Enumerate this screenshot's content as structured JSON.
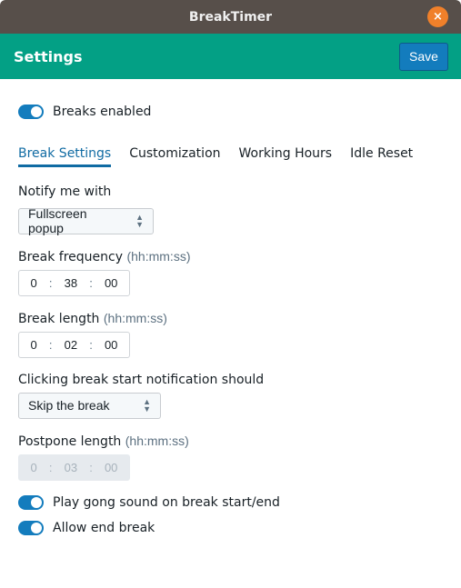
{
  "window": {
    "title": "BreakTimer",
    "close_icon": "×"
  },
  "header": {
    "title": "Settings",
    "save_label": "Save"
  },
  "breaks_enabled": {
    "label": "Breaks enabled",
    "on": true
  },
  "tabs": [
    {
      "label": "Break Settings",
      "active": true
    },
    {
      "label": "Customization"
    },
    {
      "label": "Working Hours"
    },
    {
      "label": "Idle Reset"
    }
  ],
  "notify": {
    "label": "Notify me with",
    "value": "Fullscreen popup"
  },
  "frequency": {
    "label": "Break frequency",
    "hint": "(hh:mm:ss)",
    "h": "0",
    "m": "38",
    "s": "00"
  },
  "length": {
    "label": "Break length",
    "hint": "(hh:mm:ss)",
    "h": "0",
    "m": "02",
    "s": "00"
  },
  "click_action": {
    "label": "Clicking break start notification should",
    "value": "Skip the break"
  },
  "postpone": {
    "label": "Postpone length",
    "hint": "(hh:mm:ss)",
    "h": "0",
    "m": "03",
    "s": "00",
    "disabled": true
  },
  "gong": {
    "label": "Play gong sound on break start/end",
    "on": true
  },
  "end_break": {
    "label": "Allow end break",
    "on": true
  },
  "colors": {
    "accent": "#137cbd",
    "header": "#03a085",
    "titlebar": "#574f4a",
    "close": "#f0802a"
  }
}
